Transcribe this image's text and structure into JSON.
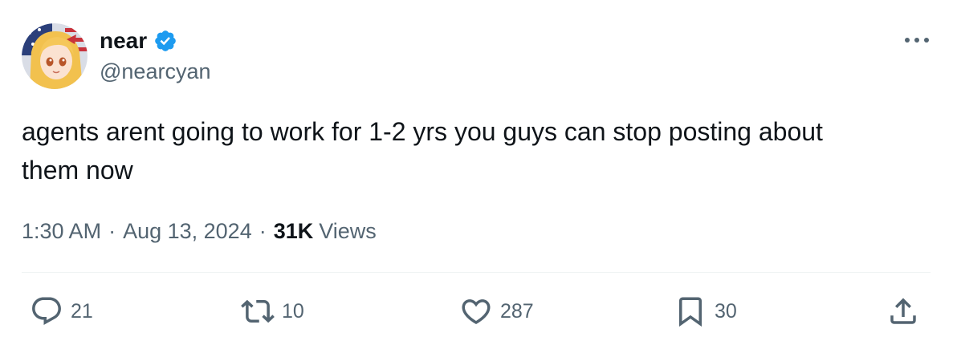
{
  "author": {
    "name": "near",
    "handle": "@nearcyan",
    "verified": true,
    "avatar_icon": "anime-girl-avatar",
    "badge_color": "#1d9bf0"
  },
  "tweet": {
    "text": "agents arent going to work for 1-2 yrs you guys can stop posting about\nthem now"
  },
  "meta": {
    "time": "1:30 AM",
    "separator": "·",
    "date": "Aug 13, 2024",
    "views_count": "31K",
    "views_label": "Views"
  },
  "actions": {
    "replies": "21",
    "retweets": "10",
    "likes": "287",
    "bookmarks": "30"
  },
  "colors": {
    "text_primary": "#0f1419",
    "text_secondary": "#536471",
    "divider": "#eff3f4"
  }
}
